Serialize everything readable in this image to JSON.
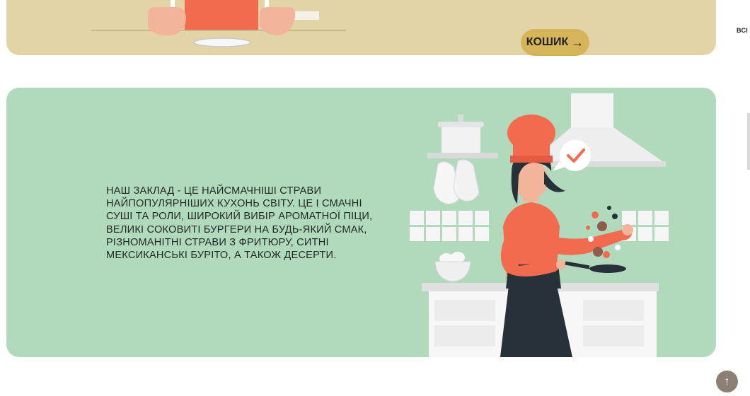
{
  "banner": {
    "cart_button_label": "КОШИК",
    "cart_button_arrow": "→"
  },
  "side": {
    "cut_label": "ВСІ"
  },
  "about": {
    "description": "НАШ ЗАКЛАД - ЦЕ НАЙСМАЧНІШІ СТРАВИ НАЙПОПУЛЯРНІШИХ КУХОНЬ СВІТУ. ЦЕ І СМАЧНІ СУШІ ТА РОЛИ, ШИРОКИЙ ВИБІР АРОМАТНОЇ ПІЦИ, ВЕЛИКІ СОКОВИТІ БУРГЕРИ НА БУДЬ-ЯКИЙ СМАК, РІЗНОМАНІТНІ СТРАВИ З ФРИТЮРУ, СИТНІ МЕКСИКАНСЬКІ БУРІТО, А ТАКОЖ ДЕСЕРТИ."
  },
  "scroll_top": {
    "icon_glyph": "↑"
  },
  "colors": {
    "banner": "#e3d4a7",
    "cart_button": "#d5b45a",
    "about_card": "#b1d9bc",
    "chef_red": "#f26b4f",
    "scroll_top": "#8c7f74"
  },
  "icons": [
    "cart-arrow-icon",
    "check-icon",
    "arrow-up-icon"
  ]
}
